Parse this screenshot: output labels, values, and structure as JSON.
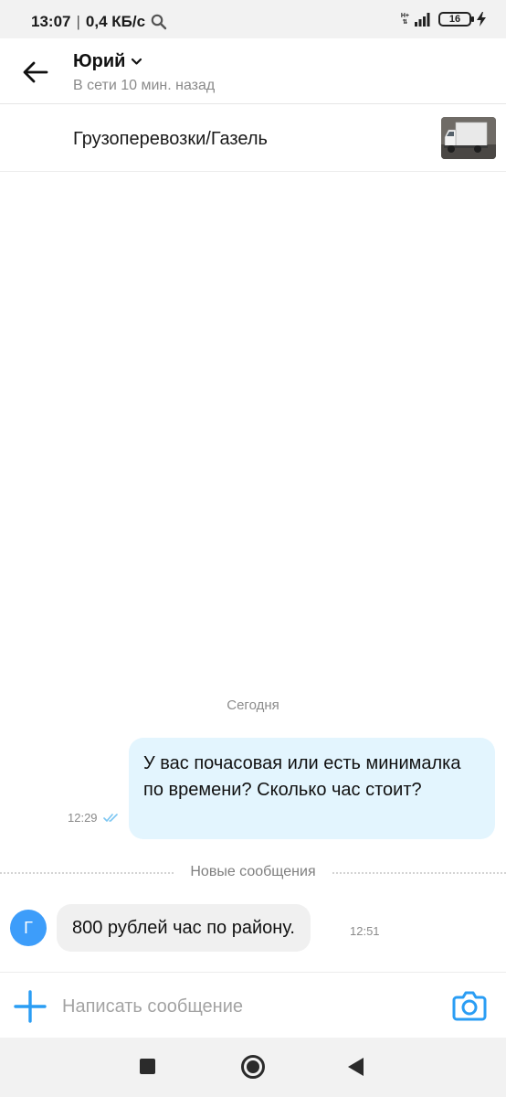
{
  "status_bar": {
    "time": "13:07",
    "net_speed": "0,4 КБ/с",
    "net_type": "H+",
    "battery": "16",
    "icons": [
      "search-icon",
      "signal-icon",
      "battery-icon",
      "charging-icon"
    ]
  },
  "header": {
    "contact_name": "Юрий",
    "status": "В сети 10 мин. назад",
    "icons": [
      "back-arrow-icon",
      "chevron-down-icon"
    ]
  },
  "listing": {
    "title": "Грузоперевозки/Газель"
  },
  "chat": {
    "date_separator": "Сегодня",
    "outgoing": {
      "text": "У вас почасовая или есть минималка по времени? Сколько час стоит?",
      "time": "12:29",
      "status_icon": "double-check-icon"
    },
    "new_messages_label": "Новые сообщения",
    "incoming": {
      "avatar_letter": "Г",
      "text": "800 рублей час по району.",
      "time": "12:51"
    }
  },
  "composer": {
    "placeholder": "Написать сообщение",
    "value": "",
    "icons": [
      "plus-icon",
      "camera-icon"
    ]
  },
  "colors": {
    "accent": "#2a9df4",
    "outgoing_bubble": "#e3f5fe",
    "incoming_bubble": "#f0f0f0",
    "avatar": "#3d9dfa"
  }
}
